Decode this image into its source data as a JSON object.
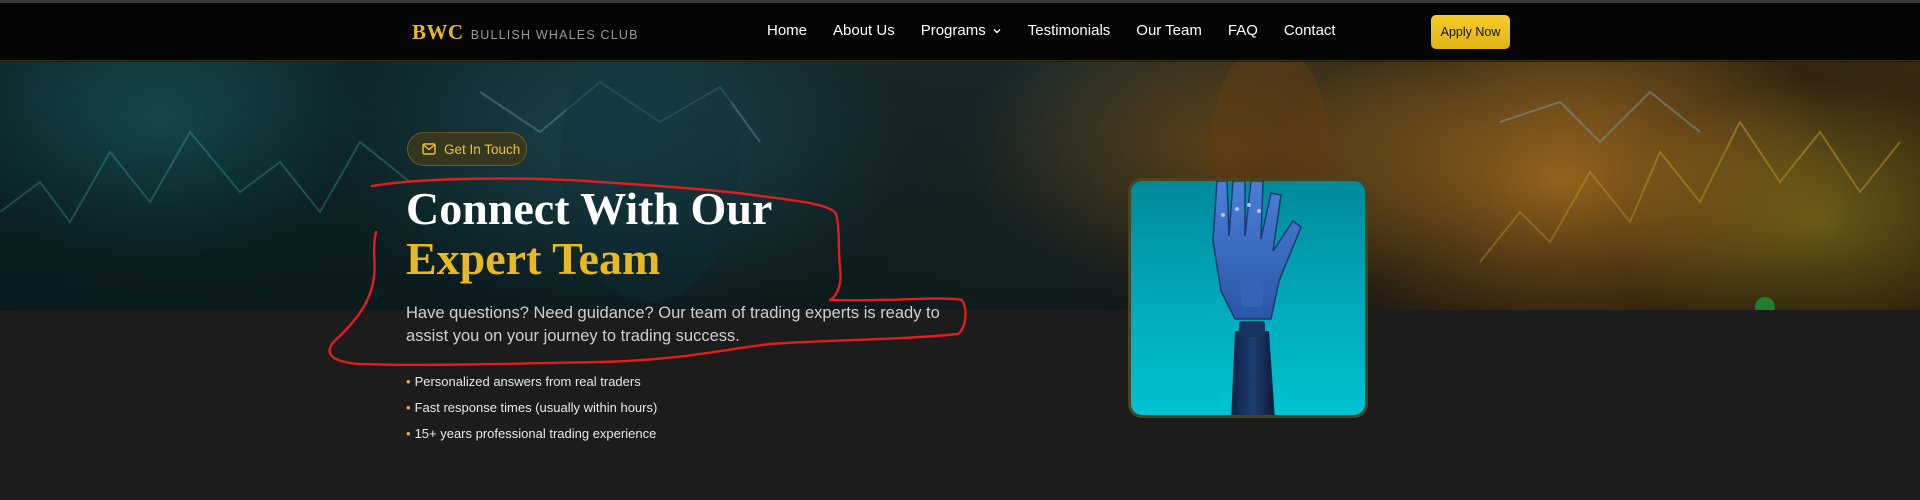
{
  "brand": {
    "mark": "BWC",
    "name": "BULLISH WHALES CLUB"
  },
  "nav": {
    "items": [
      {
        "label": "Home"
      },
      {
        "label": "About Us"
      },
      {
        "label": "Programs"
      },
      {
        "label": "Testimonials"
      },
      {
        "label": "Our Team"
      },
      {
        "label": "FAQ"
      },
      {
        "label": "Contact"
      }
    ],
    "apply_label": "Apply Now"
  },
  "hero": {
    "pill_label": "Get In Touch",
    "title_line1": "Connect With Our",
    "title_line2": "Expert Team",
    "description": "Have questions? Need guidance? Our team of trading experts is ready to assist you on your journey to trading success.",
    "bullets": [
      "Personalized answers from real traders",
      "Fast response times (usually within hours)",
      "15+ years professional trading experience"
    ],
    "photo_icon": "robot-hand-image"
  },
  "colors": {
    "accent": "#e8b923",
    "navbar_bg": "#050505",
    "page_bg": "#1c1c1c",
    "annotation": "#e01e1e"
  }
}
